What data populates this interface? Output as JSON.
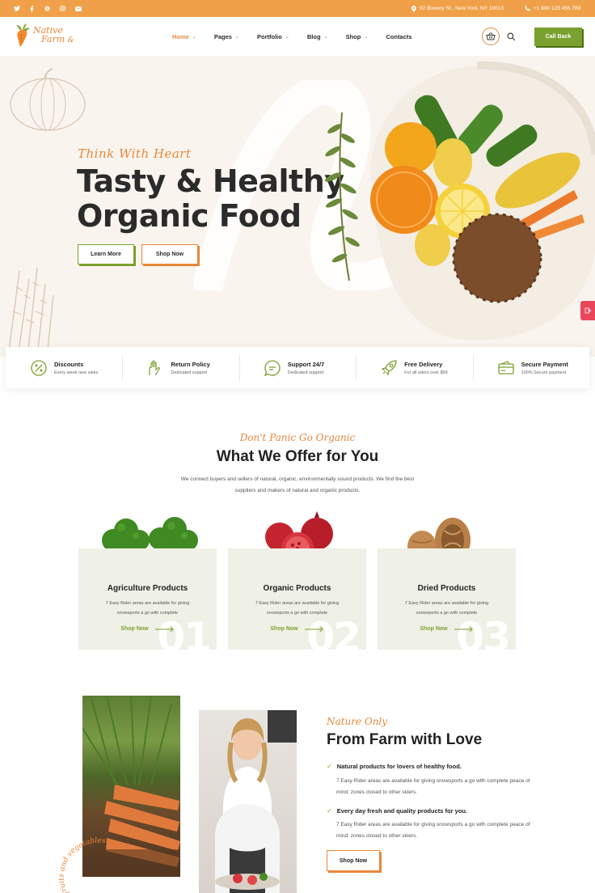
{
  "topbar": {
    "social_icons": [
      "twitter-icon",
      "facebook-icon",
      "skype-icon",
      "instagram-icon",
      "email-icon"
    ],
    "address": "92 Bowery St., New York, NY 10013",
    "phone": "+1 800 123 456 789"
  },
  "header": {
    "logo_line1": "Native",
    "logo_line2": "Farm",
    "nav": [
      {
        "label": "Home",
        "active": true
      },
      {
        "label": "Pages"
      },
      {
        "label": "Portfolio"
      },
      {
        "label": "Blog"
      },
      {
        "label": "Shop"
      },
      {
        "label": "Contacts"
      }
    ],
    "cta": "Call Back"
  },
  "hero": {
    "script": "Think With Heart",
    "title_line1": "Tasty & Healthy",
    "title_line2": "Organic Food",
    "btn_learn": "Learn More",
    "btn_shop": "Shop Now"
  },
  "features": [
    {
      "title": "Discounts",
      "sub": "Every week new sales",
      "icon": "percent-icon"
    },
    {
      "title": "Return Policy",
      "sub": "Dedicated support",
      "icon": "return-hand-icon"
    },
    {
      "title": "Support 24/7",
      "sub": "Dedicated support",
      "icon": "chat-support-icon"
    },
    {
      "title": "Free Delivery",
      "sub": "For all oders over $99",
      "icon": "rocket-icon"
    },
    {
      "title": "Secure Payment",
      "sub": "100% Secure payment",
      "icon": "credit-card-icon"
    }
  ],
  "offer": {
    "script": "Don't Panic Go Organic",
    "title": "What We Offer for You",
    "desc": "We connect buyers and sellers of natural, organic, environmentally sound products. We find the best suppliers and makers of natural and organic products.",
    "cards": [
      {
        "title": "Agriculture Products",
        "desc": "7 Easy Rider areas are available for giving snowsports a go with complete",
        "link": "Shop Now",
        "num": "01"
      },
      {
        "title": "Organic Products",
        "desc": "7 Easy Rider areas are available for giving snowsports a go with complete",
        "link": "Shop Now",
        "num": "02"
      },
      {
        "title": "Dried Products",
        "desc": "7 Easy Rider areas are available for giving snowsports a go with complete",
        "link": "Shop Now",
        "num": "03"
      }
    ]
  },
  "farm": {
    "badge_text": "fruits and vegetables",
    "script": "Nature Only",
    "title": "From Farm with Love",
    "points": [
      {
        "title": "Natural products for lovers of healthy food.",
        "desc": "7 Easy Rider areas are available for giving snowsports a go with complete peace of mind: zones closed to other skiers."
      },
      {
        "title": "Every day fresh and quality products for you.",
        "desc": "7 Easy Rider areas are available for giving snowsports a go with complete peace of mind: zones closed to other skiers."
      }
    ],
    "btn": "Shop Now"
  },
  "colors": {
    "orange": "#e8873a",
    "green": "#7aa12f",
    "topbar": "#f0a048"
  }
}
